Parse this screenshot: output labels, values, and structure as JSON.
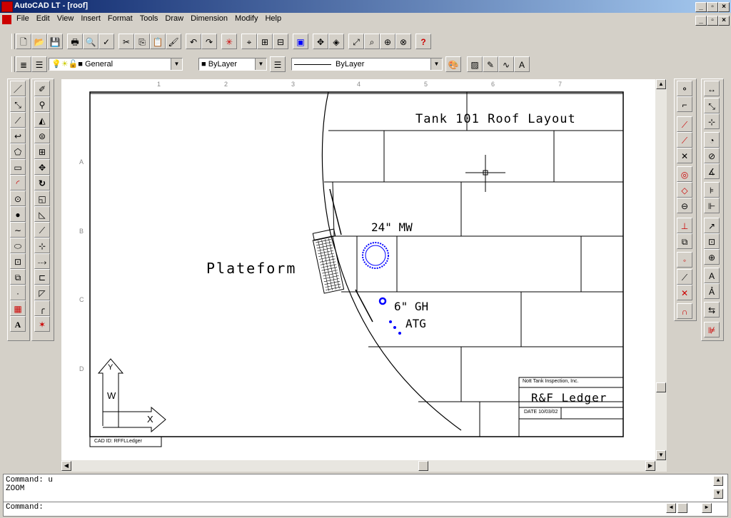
{
  "window": {
    "title": "AutoCAD LT - [roof]"
  },
  "menu": [
    "File",
    "Edit",
    "View",
    "Insert",
    "Format",
    "Tools",
    "Draw",
    "Dimension",
    "Modify",
    "Help"
  ],
  "layer_combo": "General",
  "color_combo": "ByLayer",
  "linetype_combo": "ByLayer",
  "ruler_top": [
    "1",
    "2",
    "3",
    "4",
    "5",
    "6",
    "7"
  ],
  "ruler_left": [
    "A",
    "B",
    "C",
    "D"
  ],
  "drawing": {
    "title": "Tank 101 Roof Layout",
    "mw": "24\" MW",
    "gh": "6\" GH",
    "atg": "ATG",
    "platform": "Plateform",
    "company": "Nott Tank Inspection, Inc.",
    "block_title": "R&F Ledger",
    "dated": "DATE 10/03/02",
    "cad_id": "CAD ID: RFFLLedger",
    "ucs_y": "Y",
    "ucs_w": "W",
    "ucs_x": "X"
  },
  "command": {
    "line1": "Command: u",
    "line2": "ZOOM",
    "prompt": "Command:"
  }
}
